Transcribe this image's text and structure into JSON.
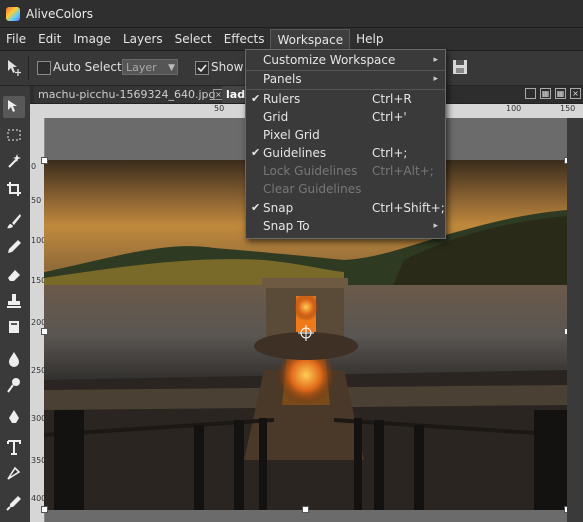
{
  "app": {
    "title": "AliveColors"
  },
  "menubar": {
    "items": [
      "File",
      "Edit",
      "Image",
      "Layers",
      "Select",
      "Effects",
      "Workspace",
      "Help"
    ]
  },
  "options": {
    "auto_select_label": "Auto Select",
    "layer_value": "Layer",
    "show_label": "Show B"
  },
  "tabs": {
    "first": "machu-picchu-1569324_640.jpg",
    "second": "lady"
  },
  "ruler": {
    "top": [
      "50",
      "100",
      "150"
    ],
    "left": [
      "0",
      "50",
      "100",
      "150",
      "200",
      "250",
      "300",
      "350",
      "400"
    ]
  },
  "workspace_menu": {
    "customize": "Customize Workspace",
    "panels": "Panels",
    "rulers": "Rulers",
    "rulers_sc": "Ctrl+R",
    "grid": "Grid",
    "grid_sc": "Ctrl+'",
    "pixel_grid": "Pixel Grid",
    "guidelines": "Guidelines",
    "guidelines_sc": "Ctrl+;",
    "lock_guidelines": "Lock Guidelines",
    "lock_guidelines_sc": "Ctrl+Alt+;",
    "clear_guidelines": "Clear Guidelines",
    "snap": "Snap",
    "snap_sc": "Ctrl+Shift+;",
    "snap_to": "Snap To",
    "check": "✔",
    "arrow": "▸"
  }
}
